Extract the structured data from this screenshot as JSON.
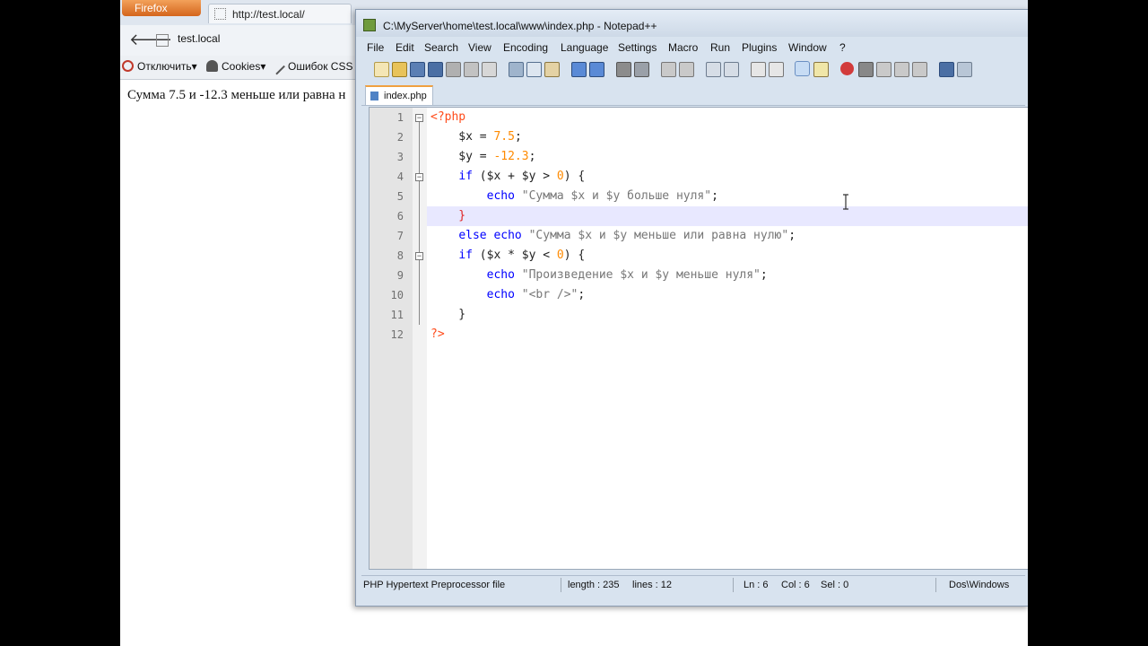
{
  "browser": {
    "menu_button": "Firefox",
    "tab_title": "http://test.local/",
    "url": "test.local",
    "devbar": {
      "disable": "Отключить▾",
      "cookies": "Cookies▾",
      "css_errors": "Ошибок CSS"
    },
    "page_text": "Сумма 7.5 и -12.3 меньше или равна н"
  },
  "notepad": {
    "title": "C:\\MyServer\\home\\test.local\\www\\index.php - Notepad++",
    "menu": [
      "File",
      "Edit",
      "Search",
      "View",
      "Encoding",
      "Language",
      "Settings",
      "Macro",
      "Run",
      "Plugins",
      "Window",
      "?"
    ],
    "tab": "index.php",
    "line_numbers": [
      "1",
      "2",
      "3",
      "4",
      "5",
      "6",
      "7",
      "8",
      "9",
      "10",
      "11",
      "12"
    ],
    "status": {
      "filetype": "PHP Hypertext Preprocessor file",
      "length": "length : 235",
      "lines": "lines : 12",
      "ln": "Ln : 6",
      "col": "Col : 6",
      "sel": "Sel : 0",
      "eol": "Dos\\Windows"
    }
  },
  "code": [
    [
      {
        "t": "<?php",
        "c": "#ff4b1a"
      }
    ],
    [
      {
        "t": "    $x = ",
        "c": "#222"
      },
      {
        "t": "7.5",
        "c": "#ff8a00"
      },
      {
        "t": ";",
        "c": "#222"
      }
    ],
    [
      {
        "t": "    $y = ",
        "c": "#222"
      },
      {
        "t": "-12.3",
        "c": "#ff8a00"
      },
      {
        "t": ";",
        "c": "#222"
      }
    ],
    [
      {
        "t": "    if ($x + $y > ",
        "c": "#222"
      },
      {
        "t": "0",
        "c": "#ff8a00"
      },
      {
        "t": ") {",
        "c": "#222"
      }
    ],
    [
      {
        "t": "        echo ",
        "c": "#222"
      },
      {
        "t": "\"Сумма $x и $y больше нуля\"",
        "c": "#777"
      },
      {
        "t": ";",
        "c": "#222"
      }
    ],
    [
      {
        "t": "    }",
        "c": "#e02020"
      }
    ],
    [
      {
        "t": "    else echo ",
        "c": "#222"
      },
      {
        "t": "\"Сумма $x и $y меньше или равна нулю\"",
        "c": "#777"
      },
      {
        "t": ";",
        "c": "#222"
      }
    ],
    [
      {
        "t": "    if ($x * $y < ",
        "c": "#222"
      },
      {
        "t": "0",
        "c": "#ff8a00"
      },
      {
        "t": ") {",
        "c": "#222"
      }
    ],
    [
      {
        "t": "        echo ",
        "c": "#222"
      },
      {
        "t": "\"Произведение $x и $y меньше нуля\"",
        "c": "#777"
      },
      {
        "t": ";",
        "c": "#222"
      }
    ],
    [
      {
        "t": "        echo ",
        "c": "#222"
      },
      {
        "t": "\"<br />\"",
        "c": "#777"
      },
      {
        "t": ";",
        "c": "#222"
      }
    ],
    [
      {
        "t": "    }",
        "c": "#222"
      }
    ],
    [
      {
        "t": "?>",
        "c": "#ff4b1a"
      }
    ]
  ],
  "colors": {
    "keyword": "#0000ff",
    "variable": "#222222",
    "number": "#ff8a00",
    "string": "#777777",
    "php_tag": "#ff4b1a",
    "current_line_highlight": "#e8e8ff"
  }
}
